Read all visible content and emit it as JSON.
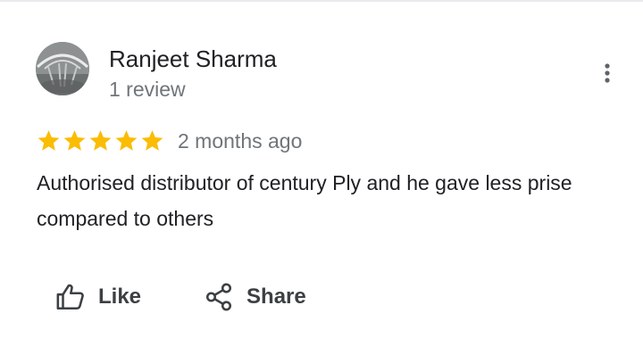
{
  "review": {
    "author_name": "Ranjeet Sharma",
    "review_count": "1 review",
    "rating": 5,
    "max_rating": 5,
    "time_ago": "2 months ago",
    "text": "Authorised distributor of century Ply and he gave less prise compared to others"
  },
  "actions": {
    "like_label": "Like",
    "share_label": "Share"
  },
  "icons": {
    "avatar": "avatar-photo",
    "more": "more-vert-icon",
    "star": "star-icon",
    "like": "thumb-up-icon",
    "share": "share-icon"
  },
  "colors": {
    "star": "#fbbc04",
    "text": "#202124",
    "secondary_text": "#70757a",
    "action_text": "#3c4043"
  }
}
